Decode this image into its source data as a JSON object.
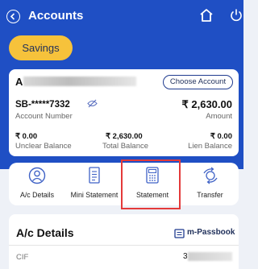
{
  "header": {
    "title": "Accounts"
  },
  "account_type_chip": "Savings",
  "account_card": {
    "name_initial": "A",
    "choose_button": "Choose Account",
    "account_number": "SB-*****7332",
    "account_number_label": "Account Number",
    "amount": "₹ 2,630.00",
    "amount_label": "Amount",
    "unclear_balance": "₹ 0.00",
    "unclear_balance_label": "Unclear Balance",
    "total_balance": "₹ 2,630.00",
    "total_balance_label": "Total Balance",
    "lien_balance": "₹ 0.00",
    "lien_balance_label": "Lien Balance"
  },
  "actions": [
    {
      "label": "A/c Details",
      "icon": "user-circle-icon"
    },
    {
      "label": "Mini Statement",
      "icon": "document-icon"
    },
    {
      "label": "Statement",
      "icon": "calculator-icon"
    },
    {
      "label": "Transfer",
      "icon": "transfer-icon"
    }
  ],
  "details": {
    "title": "A/c Details",
    "passbook_label": "m-Passbook",
    "cif_label": "CIF",
    "cif_value": "3"
  },
  "colors": {
    "header": "#1f4fc4",
    "accent": "#f6c23b",
    "highlight": "#e43a3a"
  }
}
